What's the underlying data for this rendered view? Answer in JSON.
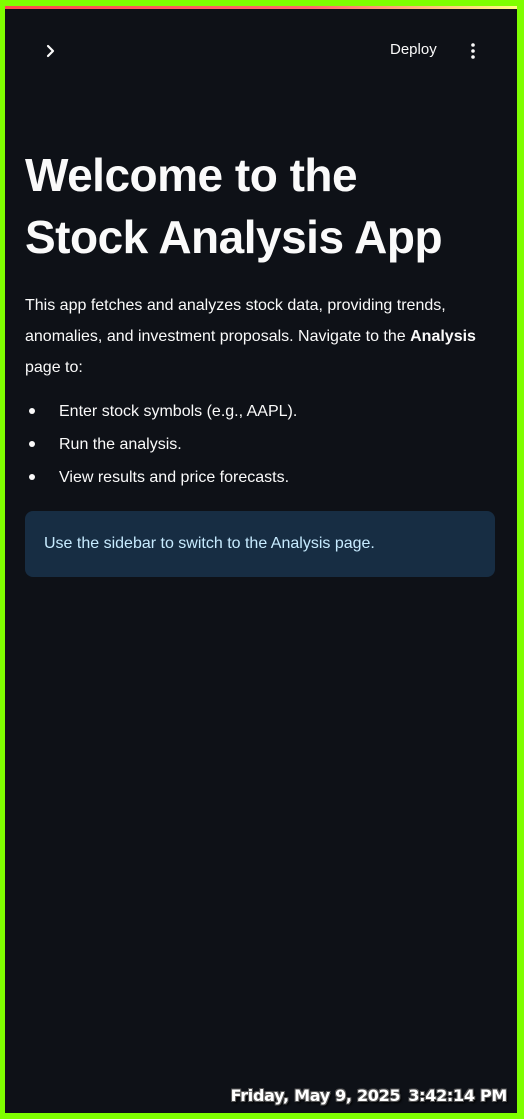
{
  "header": {
    "deploy_label": "Deploy",
    "sidebar_toggle_icon": "chevron-right-icon",
    "menu_icon": "more-vertical-icon"
  },
  "main": {
    "title_line1": "Welcome to the",
    "title_line2": "Stock Analysis App",
    "intro_text": "This app fetches and analyzes stock data, providing trends, anomalies, and investment proposals. Navigate to the",
    "intro_bold": "Analysis",
    "intro_tail": "page to:",
    "bullets": [
      "Enter stock symbols (e.g., AAPL).",
      "Run the analysis.",
      "View results and price forecasts."
    ],
    "info_text": "Use the sidebar to switch to the Analysis page."
  },
  "overlay": {
    "date": "Friday, May 9, 2025",
    "time": "3:42:14 PM"
  },
  "colors": {
    "background": "#0e1117",
    "text": "#fafafa",
    "info_bg": "#172d43",
    "info_text": "#c7ebff",
    "frame": "#7fff00"
  }
}
